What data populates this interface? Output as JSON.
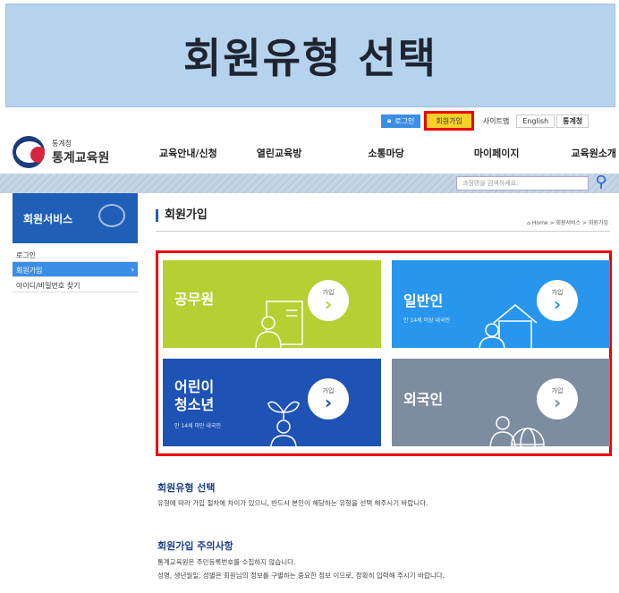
{
  "banner": {
    "title": "회원유형 선택"
  },
  "util": {
    "login": "로그인",
    "join": "회원가입",
    "sitemap": "사이트맵",
    "english": "English",
    "stats": "통계청"
  },
  "logo": {
    "org": "통계청",
    "name": "통계교육원"
  },
  "gnb": [
    "교육안내/신청",
    "열린교육방",
    "소통마당",
    "마이페이지",
    "교육원소개"
  ],
  "search": {
    "placeholder": "과정명을 검색하세요."
  },
  "sidebar": {
    "title": "회원서비스",
    "items": [
      {
        "label": "로그인"
      },
      {
        "label": "회원가입",
        "arrow": "›"
      },
      {
        "label": "아이디/비밀번호 찾기"
      }
    ]
  },
  "main": {
    "title": "회원가입",
    "breadcrumb": "Home > 회원서비스 > 회원가입"
  },
  "cards": [
    {
      "name": "공무원",
      "desc": "",
      "join": "가입",
      "chev": "›",
      "color": "#b6cf33"
    },
    {
      "name": "일반인",
      "desc": "만 14세 이상 내국인",
      "join": "가입",
      "chev": "›",
      "color": "#2796ec"
    },
    {
      "name": "어린이\n청소년",
      "name1": "어린이",
      "name2": "청소년",
      "desc": "만 14세 미만 내국인",
      "join": "가입",
      "chev": "›",
      "color": "#1e52b4"
    },
    {
      "name": "외국인",
      "desc": "",
      "join": "가입",
      "chev": "›",
      "color": "#7d8c9f"
    }
  ],
  "sections": [
    {
      "title": "회원유형 선택",
      "lines": [
        "유형에 따라 가입 절차에 차이가 있으니, 반드시 본인이 해당하는 유형을 선택 해주시기 바랍니다."
      ]
    },
    {
      "title": "회원가입 주의사항",
      "lines": [
        "통계교육원은 주민등록번호를 수집하지 않습니다.",
        "성명, 생년월일, 성별은 회원님의 정보를 구별하는 중요한 정보 이므로, 정확히 입력해 주시기 바랍니다."
      ]
    }
  ]
}
